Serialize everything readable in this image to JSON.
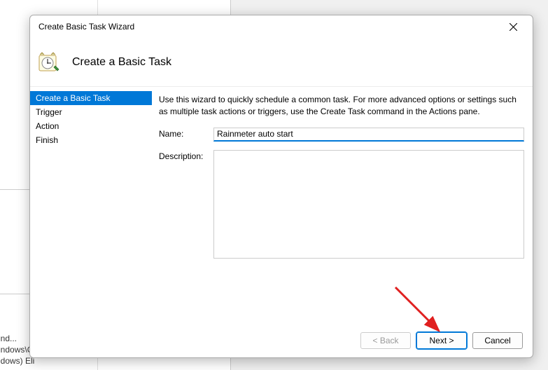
{
  "background": {
    "paths": [
      "oft\\Windows\\O...",
      "ft\\Windows) Eli"
    ],
    "truncated1": "oft\\Wind...",
    "truncated2": "oft\\Windows\\O..."
  },
  "wizard": {
    "title": "Create Basic Task Wizard",
    "header_title": "Create a Basic Task",
    "intro": "Use this wizard to quickly schedule a common task.  For more advanced options or settings such as multiple task actions or triggers, use the Create Task command in the Actions pane.",
    "sidebar": {
      "items": [
        {
          "label": "Create a Basic Task",
          "selected": true
        },
        {
          "label": "Trigger",
          "selected": false
        },
        {
          "label": "Action",
          "selected": false
        },
        {
          "label": "Finish",
          "selected": false
        }
      ]
    },
    "fields": {
      "name_label": "Name:",
      "name_value": "Rainmeter auto start",
      "description_label": "Description:",
      "description_value": ""
    },
    "buttons": {
      "back": "< Back",
      "next": "Next >",
      "cancel": "Cancel"
    }
  }
}
